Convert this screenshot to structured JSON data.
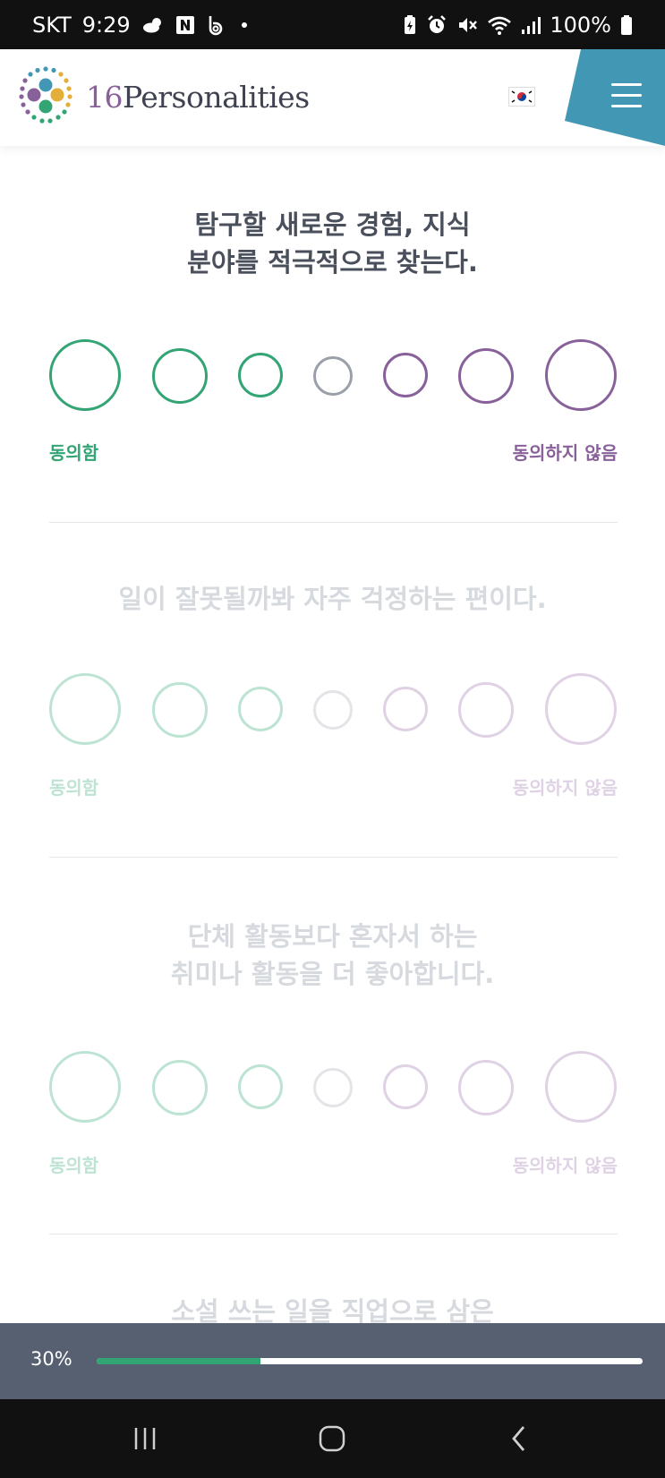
{
  "status_bar": {
    "carrier": "SKT",
    "time": "9:29",
    "battery": "100%",
    "left_icons": [
      "weather-cloud-icon",
      "naver-icon",
      "b-app-icon",
      "dot-icon"
    ],
    "right_icons": [
      "battery-saver-icon",
      "alarm-icon",
      "mute-icon",
      "wifi-icon",
      "signal-icon",
      "battery-icon"
    ]
  },
  "header": {
    "logo_num": "16",
    "logo_word": "Personalities",
    "language_flag": "korea-flag-icon",
    "menu_icon": "hamburger-menu-icon"
  },
  "colors": {
    "agree": "#33a474",
    "disagree": "#88619a",
    "neutral": "#9b9faa",
    "menu_bg": "#4298b4",
    "progress_bg": "#576071"
  },
  "questions": [
    {
      "lines": [
        "탐구할 새로운 경험, 지식",
        "분야를 적극적으로 찾는다."
      ],
      "agree_label": "동의함",
      "disagree_label": "동의하지 않음",
      "active": true
    },
    {
      "lines": [
        "일이 잘못될까봐 자주 걱정하는 편이다."
      ],
      "agree_label": "동의함",
      "disagree_label": "동의하지 않음",
      "active": false
    },
    {
      "lines": [
        "단체 활동보다 혼자서 하는",
        "취미나 활동을 더 좋아합니다."
      ],
      "agree_label": "동의함",
      "disagree_label": "동의하지 않음",
      "active": false
    },
    {
      "lines": [
        "소설 쓰는 일을 직업으로 삼은"
      ],
      "active": false
    }
  ],
  "progress": {
    "label": "30%",
    "value": 0.3
  },
  "nav_bar": {
    "icons": [
      "recent-apps-icon",
      "home-icon",
      "back-icon"
    ]
  }
}
